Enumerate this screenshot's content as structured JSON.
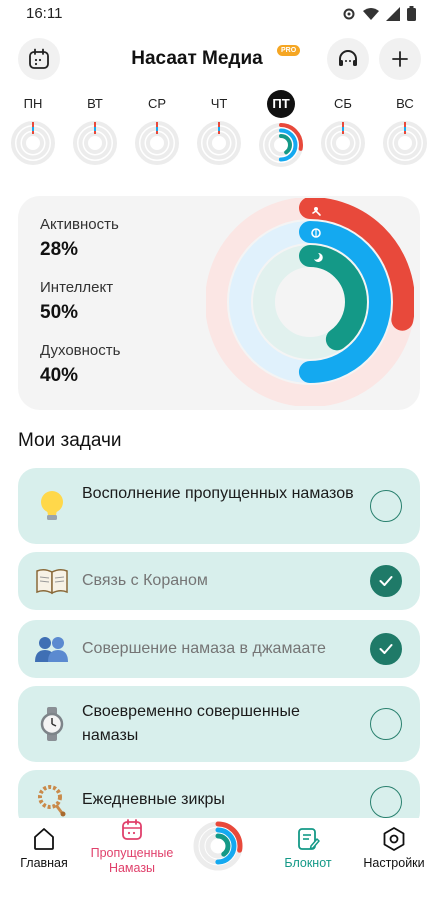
{
  "status_bar": {
    "time": "16:11",
    "icons": [
      "settings-gear-icon",
      "wifi-icon",
      "signal-icon",
      "battery-icon"
    ]
  },
  "header": {
    "title": "Насаат Медиа",
    "badge": "PRO",
    "left_icon": "calendar-icon",
    "right_icons": [
      "headset-icon",
      "plus-icon"
    ]
  },
  "week": {
    "days": [
      {
        "label": "ПН",
        "active": false
      },
      {
        "label": "ВТ",
        "active": false
      },
      {
        "label": "СР",
        "active": false
      },
      {
        "label": "ЧТ",
        "active": false
      },
      {
        "label": "ПТ",
        "active": true
      },
      {
        "label": "СБ",
        "active": false
      },
      {
        "label": "ВС",
        "active": false
      }
    ]
  },
  "stats": {
    "items": [
      {
        "label": "Активность",
        "value": "28%",
        "color": "#e8493b",
        "fraction": 0.28
      },
      {
        "label": "Интеллект",
        "value": "50%",
        "color": "#14a9f0",
        "fraction": 0.5
      },
      {
        "label": "Духовность",
        "value": "40%",
        "color": "#149987",
        "fraction": 0.4
      }
    ]
  },
  "tasks_section": {
    "title": "Мои задачи",
    "tasks": [
      {
        "text": "Восполнение пропущенных намазов",
        "icon": "lightbulb-icon",
        "done": false
      },
      {
        "text": "Связь с Кораном",
        "icon": "open-book-icon",
        "done": true
      },
      {
        "text": "Совершение намаза в джамаате",
        "icon": "people-icon",
        "done": true
      },
      {
        "text": "Своевременно совершенные намазы",
        "icon": "wristwatch-icon",
        "done": false
      },
      {
        "text": "Ежедневные зикры",
        "icon": "prayer-beads-icon",
        "done": false
      }
    ]
  },
  "bottom_nav": {
    "items": [
      {
        "label": "Главная",
        "icon": "home-icon",
        "color": "#111111"
      },
      {
        "label": "Пропущенные Намазы",
        "icon": "calendar-missed-icon",
        "color": "#e0406b"
      },
      {
        "label": "",
        "icon": "activity-rings-icon",
        "color": "#111111"
      },
      {
        "label": "Блокнот",
        "icon": "notepad-icon",
        "color": "#149987"
      },
      {
        "label": "Настройки",
        "icon": "settings-icon",
        "color": "#111111"
      }
    ]
  },
  "colors": {
    "accent_red": "#e8493b",
    "accent_blue": "#14a9f0",
    "accent_green": "#149987",
    "task_bg": "#d8efec"
  }
}
